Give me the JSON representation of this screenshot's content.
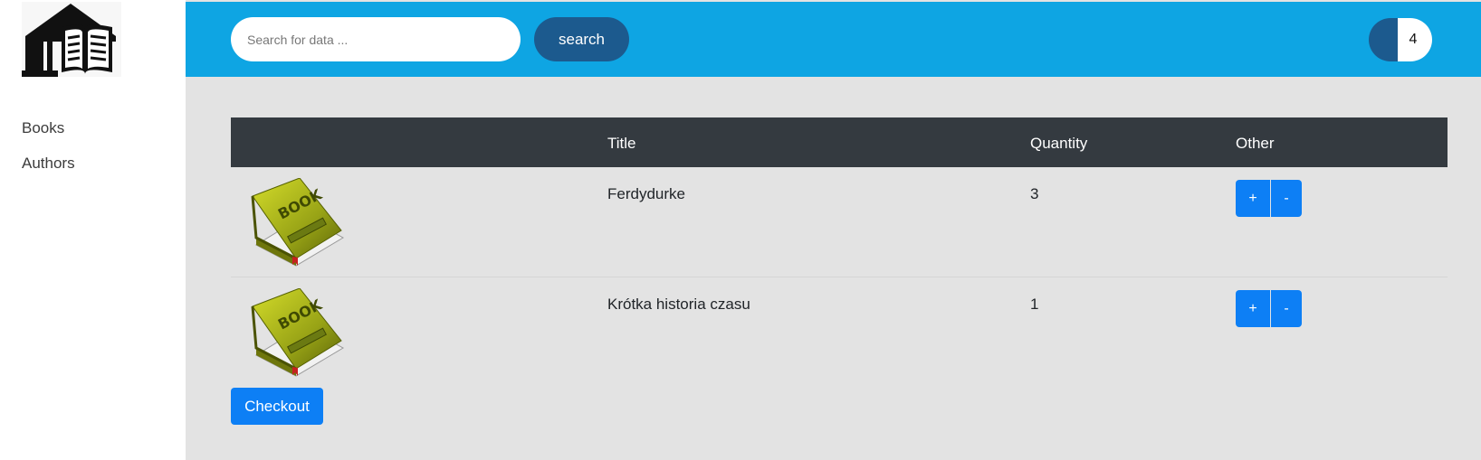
{
  "icons": {
    "logo": "library-book-icon",
    "book": "book-icon"
  },
  "colors": {
    "topbar": "#0ea5e3",
    "dark_accent": "#1c5a8e",
    "primary_button": "#0d7ff5",
    "table_header": "#343a40",
    "page_background": "#e3e3e3"
  },
  "sidebar": {
    "items": [
      {
        "label": "Books"
      },
      {
        "label": "Authors"
      }
    ]
  },
  "search": {
    "placeholder": "Search for data ...",
    "value": "",
    "button_label": "search"
  },
  "cart": {
    "count": "4"
  },
  "table": {
    "headers": [
      "",
      "Title",
      "Quantity",
      "Other"
    ],
    "rows": [
      {
        "title": "Ferdydurke",
        "quantity": "3",
        "plus_label": "+",
        "minus_label": "-"
      },
      {
        "title": "Krótka historia czasu",
        "quantity": "1",
        "plus_label": "+",
        "minus_label": "-"
      }
    ]
  },
  "book_cover_text": "BOOK",
  "checkout_label": "Checkout"
}
